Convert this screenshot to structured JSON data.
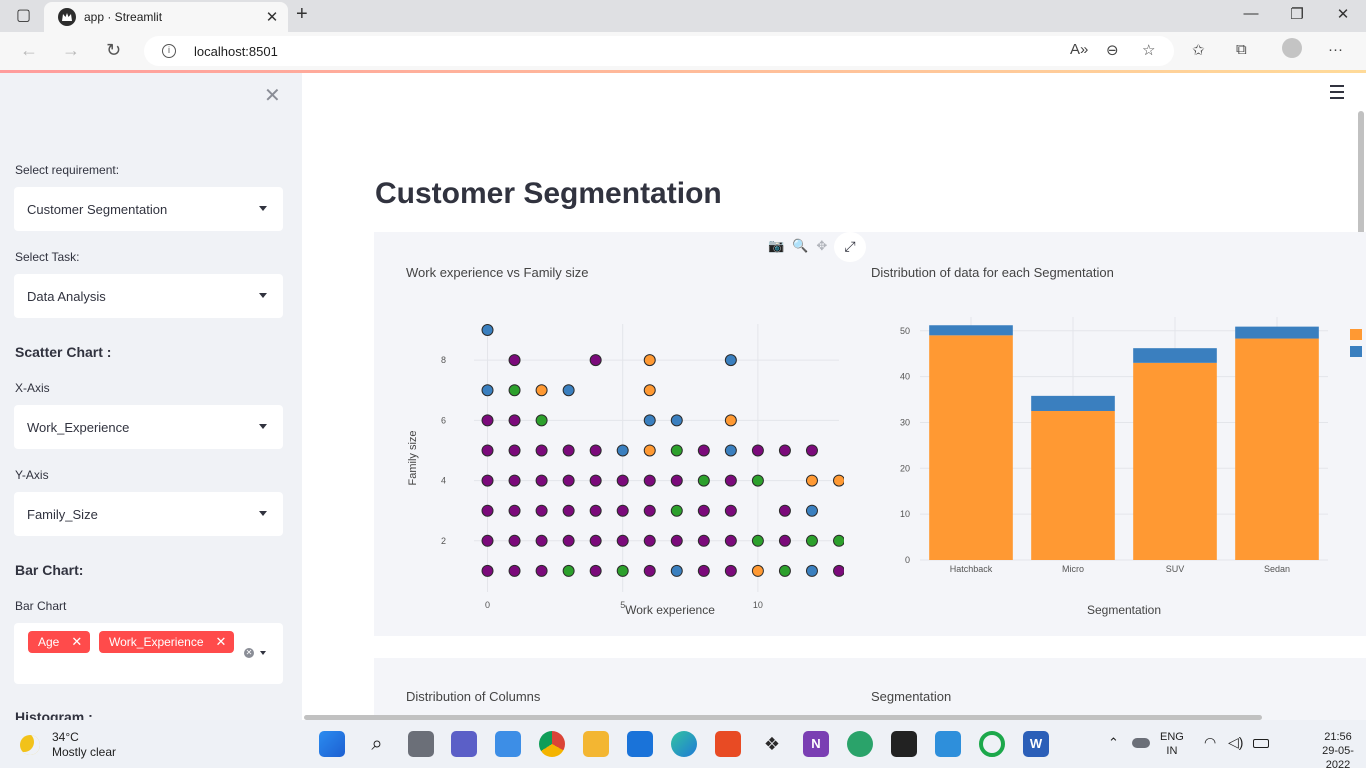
{
  "browser": {
    "tab_title": "app · Streamlit",
    "url": "localhost:8501"
  },
  "sidebar": {
    "requirement_label": "Select requirement:",
    "requirement_value": "Customer Segmentation",
    "task_label": "Select Task:",
    "task_value": "Data Analysis",
    "scatter_heading": "Scatter Chart :",
    "x_axis_label": "X-Axis",
    "x_axis_value": "Work_Experience",
    "y_axis_label": "Y-Axis",
    "y_axis_value": "Family_Size",
    "bar_heading": "Bar Chart:",
    "bar_label": "Bar Chart",
    "bar_chips": [
      "Age",
      "Work_Experience"
    ],
    "histogram_heading": "Histogram :"
  },
  "main": {
    "page_title": "Customer Segmentation",
    "chart1_title": "Work experience vs Family size",
    "chart2_title": "Distribution of data for each Segmentation",
    "chart3_title": "Distribution of Columns",
    "chart4_title": "Segmentation"
  },
  "taskbar": {
    "temperature": "34°C",
    "weather": "Mostly clear",
    "lang": "ENG",
    "region": "IN",
    "time": "21:56",
    "date": "29-05-2022"
  },
  "colors": {
    "purple": "#7b0a7b",
    "green": "#2ca02c",
    "orange": "#ff9933",
    "blue": "#3a7fbf",
    "accent": "#ff4b4b"
  },
  "chart_data": [
    {
      "type": "scatter",
      "title": "Work experience vs Family size",
      "xlabel": "Work experience",
      "ylabel": "Family size",
      "xlim": [
        -0.5,
        13
      ],
      "ylim": [
        0.3,
        9.2
      ],
      "xticks": [
        0,
        5,
        10
      ],
      "yticks": [
        2,
        4,
        6,
        8
      ],
      "points": [
        {
          "x": 0,
          "y": 9,
          "c": "blue"
        },
        {
          "x": 1,
          "y": 8,
          "c": "purple"
        },
        {
          "x": 4,
          "y": 8,
          "c": "purple"
        },
        {
          "x": 6,
          "y": 8,
          "c": "orange"
        },
        {
          "x": 9,
          "y": 8,
          "c": "blue"
        },
        {
          "x": 0,
          "y": 7,
          "c": "blue"
        },
        {
          "x": 1,
          "y": 7,
          "c": "green"
        },
        {
          "x": 2,
          "y": 7,
          "c": "orange"
        },
        {
          "x": 3,
          "y": 7,
          "c": "blue"
        },
        {
          "x": 6,
          "y": 7,
          "c": "orange"
        },
        {
          "x": 0,
          "y": 6,
          "c": "purple"
        },
        {
          "x": 1,
          "y": 6,
          "c": "purple"
        },
        {
          "x": 2,
          "y": 6,
          "c": "green"
        },
        {
          "x": 6,
          "y": 6,
          "c": "blue"
        },
        {
          "x": 7,
          "y": 6,
          "c": "blue"
        },
        {
          "x": 9,
          "y": 6,
          "c": "orange"
        },
        {
          "x": 0,
          "y": 5,
          "c": "purple"
        },
        {
          "x": 1,
          "y": 5,
          "c": "purple"
        },
        {
          "x": 2,
          "y": 5,
          "c": "purple"
        },
        {
          "x": 3,
          "y": 5,
          "c": "purple"
        },
        {
          "x": 4,
          "y": 5,
          "c": "purple"
        },
        {
          "x": 5,
          "y": 5,
          "c": "blue"
        },
        {
          "x": 6,
          "y": 5,
          "c": "orange"
        },
        {
          "x": 7,
          "y": 5,
          "c": "green"
        },
        {
          "x": 8,
          "y": 5,
          "c": "purple"
        },
        {
          "x": 9,
          "y": 5,
          "c": "blue"
        },
        {
          "x": 10,
          "y": 5,
          "c": "purple"
        },
        {
          "x": 11,
          "y": 5,
          "c": "purple"
        },
        {
          "x": 12,
          "y": 5,
          "c": "purple"
        },
        {
          "x": 0,
          "y": 4,
          "c": "purple"
        },
        {
          "x": 1,
          "y": 4,
          "c": "purple"
        },
        {
          "x": 2,
          "y": 4,
          "c": "purple"
        },
        {
          "x": 3,
          "y": 4,
          "c": "purple"
        },
        {
          "x": 4,
          "y": 4,
          "c": "purple"
        },
        {
          "x": 5,
          "y": 4,
          "c": "purple"
        },
        {
          "x": 6,
          "y": 4,
          "c": "purple"
        },
        {
          "x": 7,
          "y": 4,
          "c": "purple"
        },
        {
          "x": 8,
          "y": 4,
          "c": "green"
        },
        {
          "x": 9,
          "y": 4,
          "c": "purple"
        },
        {
          "x": 10,
          "y": 4,
          "c": "green"
        },
        {
          "x": 12,
          "y": 4,
          "c": "orange"
        },
        {
          "x": 13,
          "y": 4,
          "c": "orange"
        },
        {
          "x": 0,
          "y": 3,
          "c": "purple"
        },
        {
          "x": 1,
          "y": 3,
          "c": "purple"
        },
        {
          "x": 2,
          "y": 3,
          "c": "purple"
        },
        {
          "x": 3,
          "y": 3,
          "c": "purple"
        },
        {
          "x": 4,
          "y": 3,
          "c": "purple"
        },
        {
          "x": 5,
          "y": 3,
          "c": "purple"
        },
        {
          "x": 6,
          "y": 3,
          "c": "purple"
        },
        {
          "x": 7,
          "y": 3,
          "c": "green"
        },
        {
          "x": 8,
          "y": 3,
          "c": "purple"
        },
        {
          "x": 9,
          "y": 3,
          "c": "purple"
        },
        {
          "x": 11,
          "y": 3,
          "c": "purple"
        },
        {
          "x": 12,
          "y": 3,
          "c": "blue"
        },
        {
          "x": 0,
          "y": 2,
          "c": "purple"
        },
        {
          "x": 1,
          "y": 2,
          "c": "purple"
        },
        {
          "x": 2,
          "y": 2,
          "c": "purple"
        },
        {
          "x": 3,
          "y": 2,
          "c": "purple"
        },
        {
          "x": 4,
          "y": 2,
          "c": "purple"
        },
        {
          "x": 5,
          "y": 2,
          "c": "purple"
        },
        {
          "x": 6,
          "y": 2,
          "c": "purple"
        },
        {
          "x": 7,
          "y": 2,
          "c": "purple"
        },
        {
          "x": 8,
          "y": 2,
          "c": "purple"
        },
        {
          "x": 9,
          "y": 2,
          "c": "purple"
        },
        {
          "x": 10,
          "y": 2,
          "c": "green"
        },
        {
          "x": 11,
          "y": 2,
          "c": "purple"
        },
        {
          "x": 12,
          "y": 2,
          "c": "green"
        },
        {
          "x": 13,
          "y": 2,
          "c": "green"
        },
        {
          "x": 0,
          "y": 1,
          "c": "purple"
        },
        {
          "x": 1,
          "y": 1,
          "c": "purple"
        },
        {
          "x": 2,
          "y": 1,
          "c": "purple"
        },
        {
          "x": 3,
          "y": 1,
          "c": "green"
        },
        {
          "x": 4,
          "y": 1,
          "c": "purple"
        },
        {
          "x": 5,
          "y": 1,
          "c": "green"
        },
        {
          "x": 6,
          "y": 1,
          "c": "purple"
        },
        {
          "x": 7,
          "y": 1,
          "c": "blue"
        },
        {
          "x": 8,
          "y": 1,
          "c": "purple"
        },
        {
          "x": 9,
          "y": 1,
          "c": "purple"
        },
        {
          "x": 10,
          "y": 1,
          "c": "orange"
        },
        {
          "x": 11,
          "y": 1,
          "c": "green"
        },
        {
          "x": 12,
          "y": 1,
          "c": "blue"
        },
        {
          "x": 13,
          "y": 1,
          "c": "purple"
        }
      ]
    },
    {
      "type": "bar",
      "title": "Distribution of data for each Segmentation",
      "xlabel": "Segmentation",
      "ylabel": "",
      "categories": [
        "Hatchback",
        "Micro",
        "SUV",
        "Sedan"
      ],
      "ylim": [
        0,
        53
      ],
      "yticks": [
        0,
        10,
        20,
        30,
        40,
        50
      ],
      "series": [
        {
          "values": [
            49,
            32.5,
            43,
            48.3
          ],
          "color": "orange"
        },
        {
          "values": [
            2.2,
            3.3,
            3.2,
            2.6
          ],
          "color": "blue"
        }
      ]
    }
  ]
}
